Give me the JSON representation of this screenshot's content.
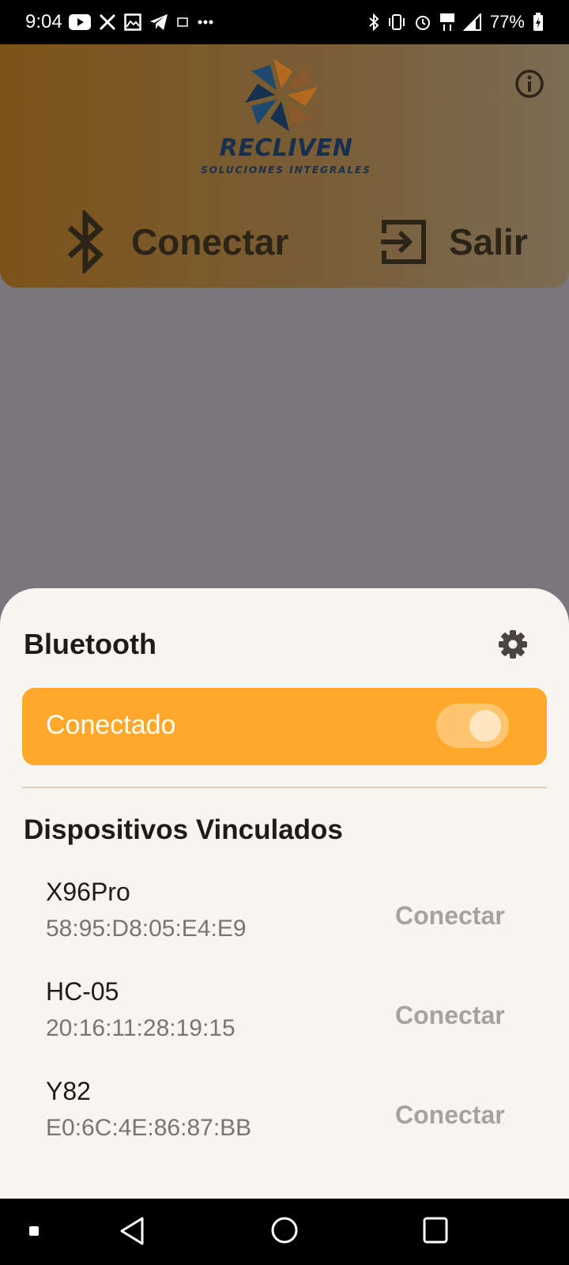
{
  "status_bar": {
    "time": "9:04",
    "battery": "77%",
    "left_icons": [
      "youtube-icon",
      "x-icon",
      "gallery-icon",
      "telegram-icon",
      "sim-icon",
      "more-icon"
    ],
    "right_icons": [
      "bluetooth-icon",
      "vibrate-icon",
      "alarm-icon",
      "lte-icon",
      "signal-icon",
      "battery-icon"
    ]
  },
  "header": {
    "logo_word": "RECLIVEN",
    "logo_subtitle": "SOLUCIONES INTEGRALES",
    "connect_label": "Conectar",
    "exit_label": "Salir",
    "info_icon": "info-icon"
  },
  "sheet": {
    "title": "Bluetooth",
    "settings_icon": "gear-icon",
    "toggle": {
      "label": "Conectado",
      "on": true
    },
    "section_title": "Dispositivos Vinculados",
    "devices": [
      {
        "name": "X96Pro",
        "mac": "58:95:D8:05:E4:E9",
        "action": "Conectar"
      },
      {
        "name": "HC-05",
        "mac": "20:16:11:28:19:15",
        "action": "Conectar"
      },
      {
        "name": "Y82",
        "mac": "E0:6C:4E:86:87:BB",
        "action": "Conectar"
      }
    ]
  },
  "nav_bar": {
    "items": [
      "recents-dot-icon",
      "back-icon",
      "home-icon",
      "overview-icon"
    ]
  },
  "colors": {
    "accent": "#ffa82c",
    "header_dark": "#7c5419",
    "sheet_bg": "#f8f5f1",
    "logo_blue": "#17304e",
    "logo_orange": "#b46a1e"
  }
}
